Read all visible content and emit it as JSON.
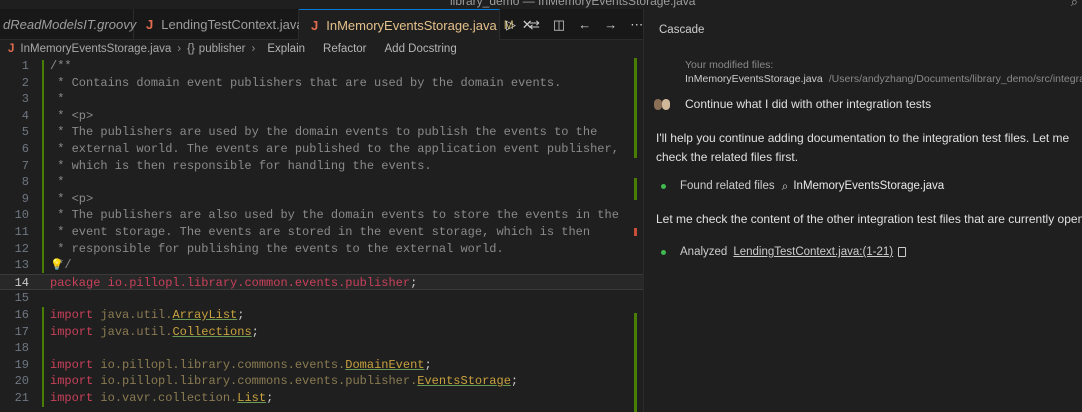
{
  "window": {
    "title": "library_demo — InMemoryEventsStorage.java"
  },
  "tabs": [
    {
      "label": "dReadModelsIT.groovy",
      "icon": "groovy-file",
      "active": false
    },
    {
      "label": "LendingTestContext.java",
      "icon": "java-file",
      "active": false
    },
    {
      "label": "InMemoryEventsStorage.java",
      "icon": "java-file",
      "active": true,
      "modified": "M"
    }
  ],
  "tab_actions": [
    "run-icon",
    "compare-icon",
    "split-editor-icon",
    "back-icon",
    "forward-icon",
    "more-icon"
  ],
  "breadcrumb": {
    "file": "InMemoryEventsStorage.java",
    "symbol": "publisher",
    "lenses": [
      "Explain",
      "Refactor",
      "Add Docstring"
    ]
  },
  "editor": {
    "current_line": 14,
    "lines": [
      {
        "n": "1",
        "text": "/**"
      },
      {
        "n": "2",
        "text": " * Contains domain event publishers that are used by the domain events."
      },
      {
        "n": "3",
        "text": " *"
      },
      {
        "n": "4",
        "text": " * <p>"
      },
      {
        "n": "5",
        "text": " * The publishers are used by the domain events to publish the events to the"
      },
      {
        "n": "6",
        "text": " * external world. The events are published to the application event publisher,"
      },
      {
        "n": "7",
        "text": " * which is then responsible for handling the events."
      },
      {
        "n": "8",
        "text": " *"
      },
      {
        "n": "9",
        "text": " * <p>"
      },
      {
        "n": "10",
        "text": " * The publishers are also used by the domain events to store the events in the"
      },
      {
        "n": "11",
        "text": " * event storage. The events are stored in the event storage, which is then"
      },
      {
        "n": "12",
        "text": " * responsible for publishing the events to the external world."
      },
      {
        "n": "13",
        "text": " */"
      },
      {
        "n": "14",
        "kw": "package",
        "pkg": "io.pillopl.library.common.events.publisher",
        "end": ";"
      },
      {
        "n": "15",
        "text": ""
      },
      {
        "n": "16",
        "kw": "import",
        "pkg": "java.util.",
        "cls": "ArrayList",
        "end": ";"
      },
      {
        "n": "17",
        "kw": "import",
        "pkg": "java.util.",
        "cls": "Collections",
        "end": ";"
      },
      {
        "n": "18",
        "text": ""
      },
      {
        "n": "19",
        "kw": "import",
        "pkg": "io.pillopl.library.commons.events.",
        "cls": "DomainEvent",
        "end": ";"
      },
      {
        "n": "20",
        "kw": "import",
        "pkg": "io.pillopl.library.commons.events.publisher.",
        "cls": "EventsStorage",
        "end": ";"
      },
      {
        "n": "21",
        "kw": "import",
        "pkg": "io.vavr.collection.",
        "cls": "List",
        "end": ";"
      }
    ]
  },
  "cascade": {
    "title": "Cascade",
    "modified_label": "Your modified files:",
    "modified_file": "InMemoryEventsStorage.java",
    "modified_path": "/Users/andyzhang/Documents/library_demo/src/integration-test/groovy",
    "user_message": "Continue what I did with other integration tests",
    "response_1": "I'll help you continue adding documentation to the integration test files. Let me check the related files first.",
    "step_1_label": "Found related files",
    "step_1_file": "InMemoryEventsStorage.java",
    "response_2": "Let me check the content of the other integration test files that are currently open.",
    "step_2_label": "Analyzed",
    "step_2_link": "LendingTestContext.java:(1-21)"
  },
  "colors": {
    "background": "#1f1f1f",
    "accent": "#0078d4",
    "keyword": "#c8405a",
    "comment": "#8a8a8a",
    "step_dot": "#3fb950"
  }
}
